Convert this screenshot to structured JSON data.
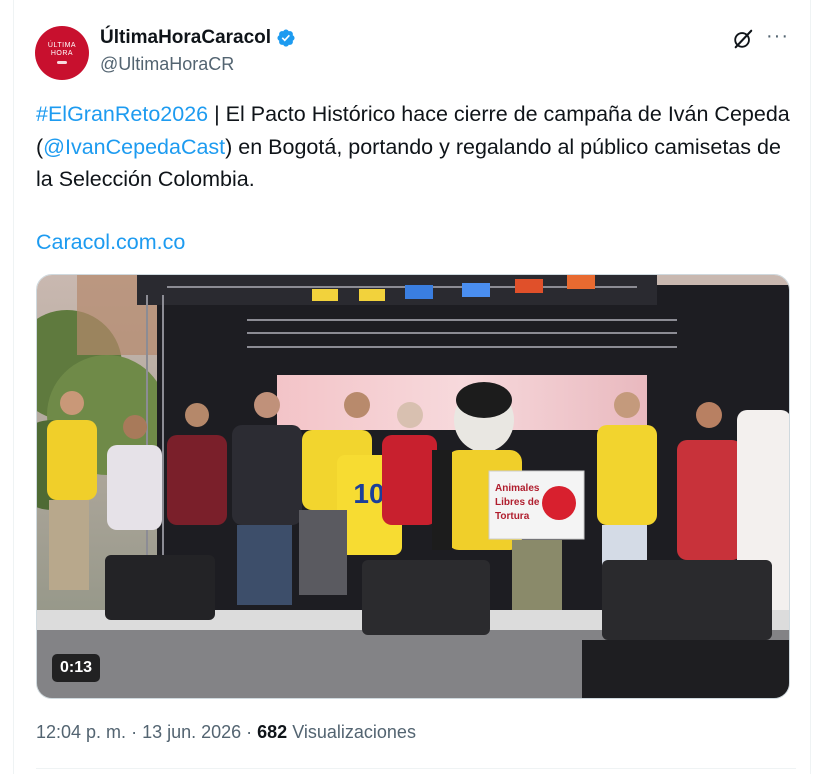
{
  "author": {
    "display_name": "ÚltimaHoraCaracol",
    "handle": "@UltimaHoraCR",
    "avatar_line1": "ÚLTIMA",
    "avatar_line2": "HORA",
    "verified_icon": "verified-badge-icon",
    "brand_color": "#c8102e"
  },
  "actions": {
    "grok_icon": "grok-icon",
    "more_label": "···"
  },
  "tweet": {
    "hashtag": "#ElGranReto2026",
    "text_part1": " | El Pacto Histórico hace cierre de campaña de Iván Cepeda (",
    "mention": "@IvanCepedaCast",
    "text_part2": ") en Bogotá, portando y regalando al público camisetas de la Selección Colombia.",
    "link": "Caracol.com.co",
    "link_color": "#1d9bf0"
  },
  "media": {
    "type": "video",
    "duration": "0:13",
    "banner_line1": "Animales",
    "banner_line2": "Libres de",
    "banner_line3": "Tortura",
    "jersey_number": "10"
  },
  "meta": {
    "time": "12:04 p. m.",
    "separator": " · ",
    "date": "13 jun. 2026",
    "views_count": "682",
    "views_label": " Visualizaciones"
  }
}
